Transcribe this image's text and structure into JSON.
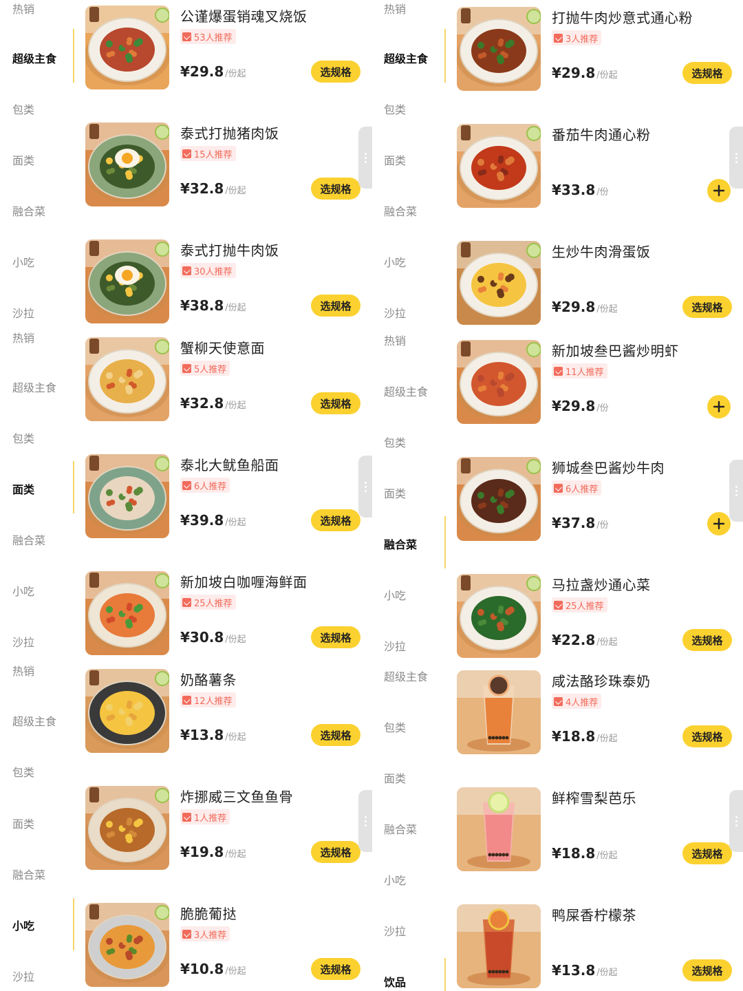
{
  "left": {
    "sidebar": [
      {
        "label": "热销",
        "active": false
      },
      {
        "label": "超级主食",
        "active": true
      },
      {
        "label": "包类",
        "active": false
      },
      {
        "label": "面类",
        "active": false
      },
      {
        "label": "融合菜",
        "active": false
      },
      {
        "label": "小吃",
        "active": false
      },
      {
        "label": "沙拉",
        "active": false
      },
      {
        "label": "热销",
        "active": false
      },
      {
        "label": "超级主食",
        "active": false
      },
      {
        "label": "包类",
        "active": false
      },
      {
        "label": "面类",
        "active": true
      },
      {
        "label": "融合菜",
        "active": false
      },
      {
        "label": "小吃",
        "active": false
      },
      {
        "label": "沙拉",
        "active": false
      },
      {
        "label": "热销",
        "active": false
      },
      {
        "label": "超级主食",
        "active": false
      },
      {
        "label": "包类",
        "active": false
      },
      {
        "label": "面类",
        "active": false
      },
      {
        "label": "融合菜",
        "active": false
      },
      {
        "label": "小吃",
        "active": true
      },
      {
        "label": "沙拉",
        "active": false
      }
    ],
    "dishes": [
      {
        "name": "公谨爆蛋销魂叉烧饭",
        "rec": "53人推荐",
        "price": "¥29.8",
        "unit": "/份起",
        "button": "选规格",
        "image": "char-siu-rice"
      },
      {
        "name": "泰式打抛猪肉饭",
        "rec": "15人推荐",
        "price": "¥32.8",
        "unit": "/份起",
        "button": "选规格",
        "image": "basil-pork-rice"
      },
      {
        "name": "泰式打抛牛肉饭",
        "rec": "30人推荐",
        "price": "¥38.8",
        "unit": "/份起",
        "button": "选规格",
        "image": "basil-beef-rice"
      },
      {
        "name": "蟹柳天使意面",
        "rec": "5人推荐",
        "price": "¥32.8",
        "unit": "/份起",
        "button": "选规格",
        "image": "crab-pasta"
      },
      {
        "name": "泰北大鱿鱼船面",
        "rec": "6人推荐",
        "price": "¥39.8",
        "unit": "/份起",
        "button": "选规格",
        "image": "squid-noodle"
      },
      {
        "name": "新加坡白咖喱海鲜面",
        "rec": "25人推荐",
        "price": "¥30.8",
        "unit": "/份起",
        "button": "选规格",
        "image": "curry-seafood-noodle"
      },
      {
        "name": "奶酪薯条",
        "rec": "12人推荐",
        "price": "¥13.8",
        "unit": "/份起",
        "button": "选规格",
        "image": "cheese-fries"
      },
      {
        "name": "炸挪威三文鱼鱼骨",
        "rec": "1人推荐",
        "price": "¥19.8",
        "unit": "/份起",
        "button": "选规格",
        "image": "fried-salmon-bone"
      },
      {
        "name": "脆脆葡挞",
        "rec": "3人推荐",
        "price": "¥10.8",
        "unit": "/份起",
        "button": "选规格",
        "image": "egg-tart"
      }
    ]
  },
  "right": {
    "sidebar": [
      {
        "label": "热销",
        "active": false
      },
      {
        "label": "超级主食",
        "active": true
      },
      {
        "label": "包类",
        "active": false
      },
      {
        "label": "面类",
        "active": false
      },
      {
        "label": "融合菜",
        "active": false
      },
      {
        "label": "小吃",
        "active": false
      },
      {
        "label": "沙拉",
        "active": false
      },
      {
        "label": "热销",
        "active": false
      },
      {
        "label": "超级主食",
        "active": false
      },
      {
        "label": "包类",
        "active": false
      },
      {
        "label": "面类",
        "active": false
      },
      {
        "label": "融合菜",
        "active": true
      },
      {
        "label": "小吃",
        "active": false
      },
      {
        "label": "沙拉",
        "active": false
      },
      {
        "label": "超级主食",
        "active": false
      },
      {
        "label": "包类",
        "active": false
      },
      {
        "label": "面类",
        "active": false
      },
      {
        "label": "融合菜",
        "active": false
      },
      {
        "label": "小吃",
        "active": false
      },
      {
        "label": "沙拉",
        "active": false
      },
      {
        "label": "饮品",
        "active": true
      }
    ],
    "dishes": [
      {
        "name": "打抛牛肉炒意式通心粉",
        "rec": "3人推荐",
        "price": "¥29.8",
        "unit": "/份起",
        "button": "选规格",
        "image": "beef-macaroni"
      },
      {
        "name": "番茄牛肉通心粉",
        "rec": "",
        "price": "¥33.8",
        "unit": "/份",
        "button": "",
        "image": "tomato-beef-macaroni"
      },
      {
        "name": "生炒牛肉滑蛋饭",
        "rec": "",
        "price": "¥29.8",
        "unit": "/份起",
        "button": "选规格",
        "image": "beef-egg-rice"
      },
      {
        "name": "新加坡叁巴酱炒明虾",
        "rec": "11人推荐",
        "price": "¥29.8",
        "unit": "/份",
        "button": "",
        "image": "sambal-prawn"
      },
      {
        "name": "狮城叁巴酱炒牛肉",
        "rec": "6人推荐",
        "price": "¥37.8",
        "unit": "/份",
        "button": "",
        "image": "sambal-beef"
      },
      {
        "name": "马拉盏炒通心菜",
        "rec": "25人推荐",
        "price": "¥22.8",
        "unit": "/份起",
        "button": "选规格",
        "image": "belacan-kangkung"
      },
      {
        "name": "咸法酪珍珠泰奶",
        "rec": "4人推荐",
        "price": "¥18.8",
        "unit": "/份起",
        "button": "选规格",
        "image": "thai-milk-tea"
      },
      {
        "name": "鲜榨雪梨芭乐",
        "rec": "",
        "price": "¥18.8",
        "unit": "/份起",
        "button": "选规格",
        "image": "pear-guava-juice"
      },
      {
        "name": "鸭屎香柠檬茶",
        "rec": "",
        "price": "¥13.8",
        "unit": "/份起",
        "button": "选规格",
        "image": "lemon-tea"
      }
    ]
  },
  "colors": {
    "accent": "#fbd130",
    "recommend": "#f26b5b",
    "recommend_bg": "#fdeceb",
    "sidebar_text": "#8a8a8a",
    "active_bar": "#f7d566"
  }
}
